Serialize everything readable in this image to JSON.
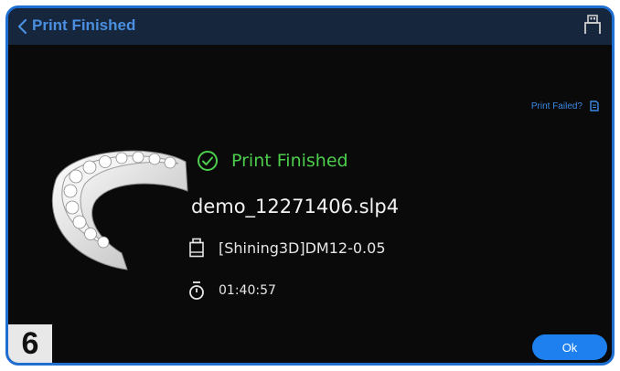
{
  "header": {
    "title": "Print Finished"
  },
  "print_failed": {
    "label": "Print Failed?"
  },
  "status": {
    "text": "Print Finished"
  },
  "job": {
    "filename": "demo_12271406.slp4",
    "resin": "[Shining3D]DM12-0.05",
    "duration": "01:40:57"
  },
  "buttons": {
    "ok": "Ok"
  },
  "badge": {
    "step": "6"
  },
  "colors": {
    "accent": "#1e80ef",
    "header_bg": "#16263c",
    "success": "#4ccd4c",
    "link": "#3b8ae6"
  },
  "icons": [
    "chevron-left-icon",
    "usb-icon",
    "document-icon",
    "check-circle-icon",
    "resin-bottle-icon",
    "timer-icon"
  ]
}
